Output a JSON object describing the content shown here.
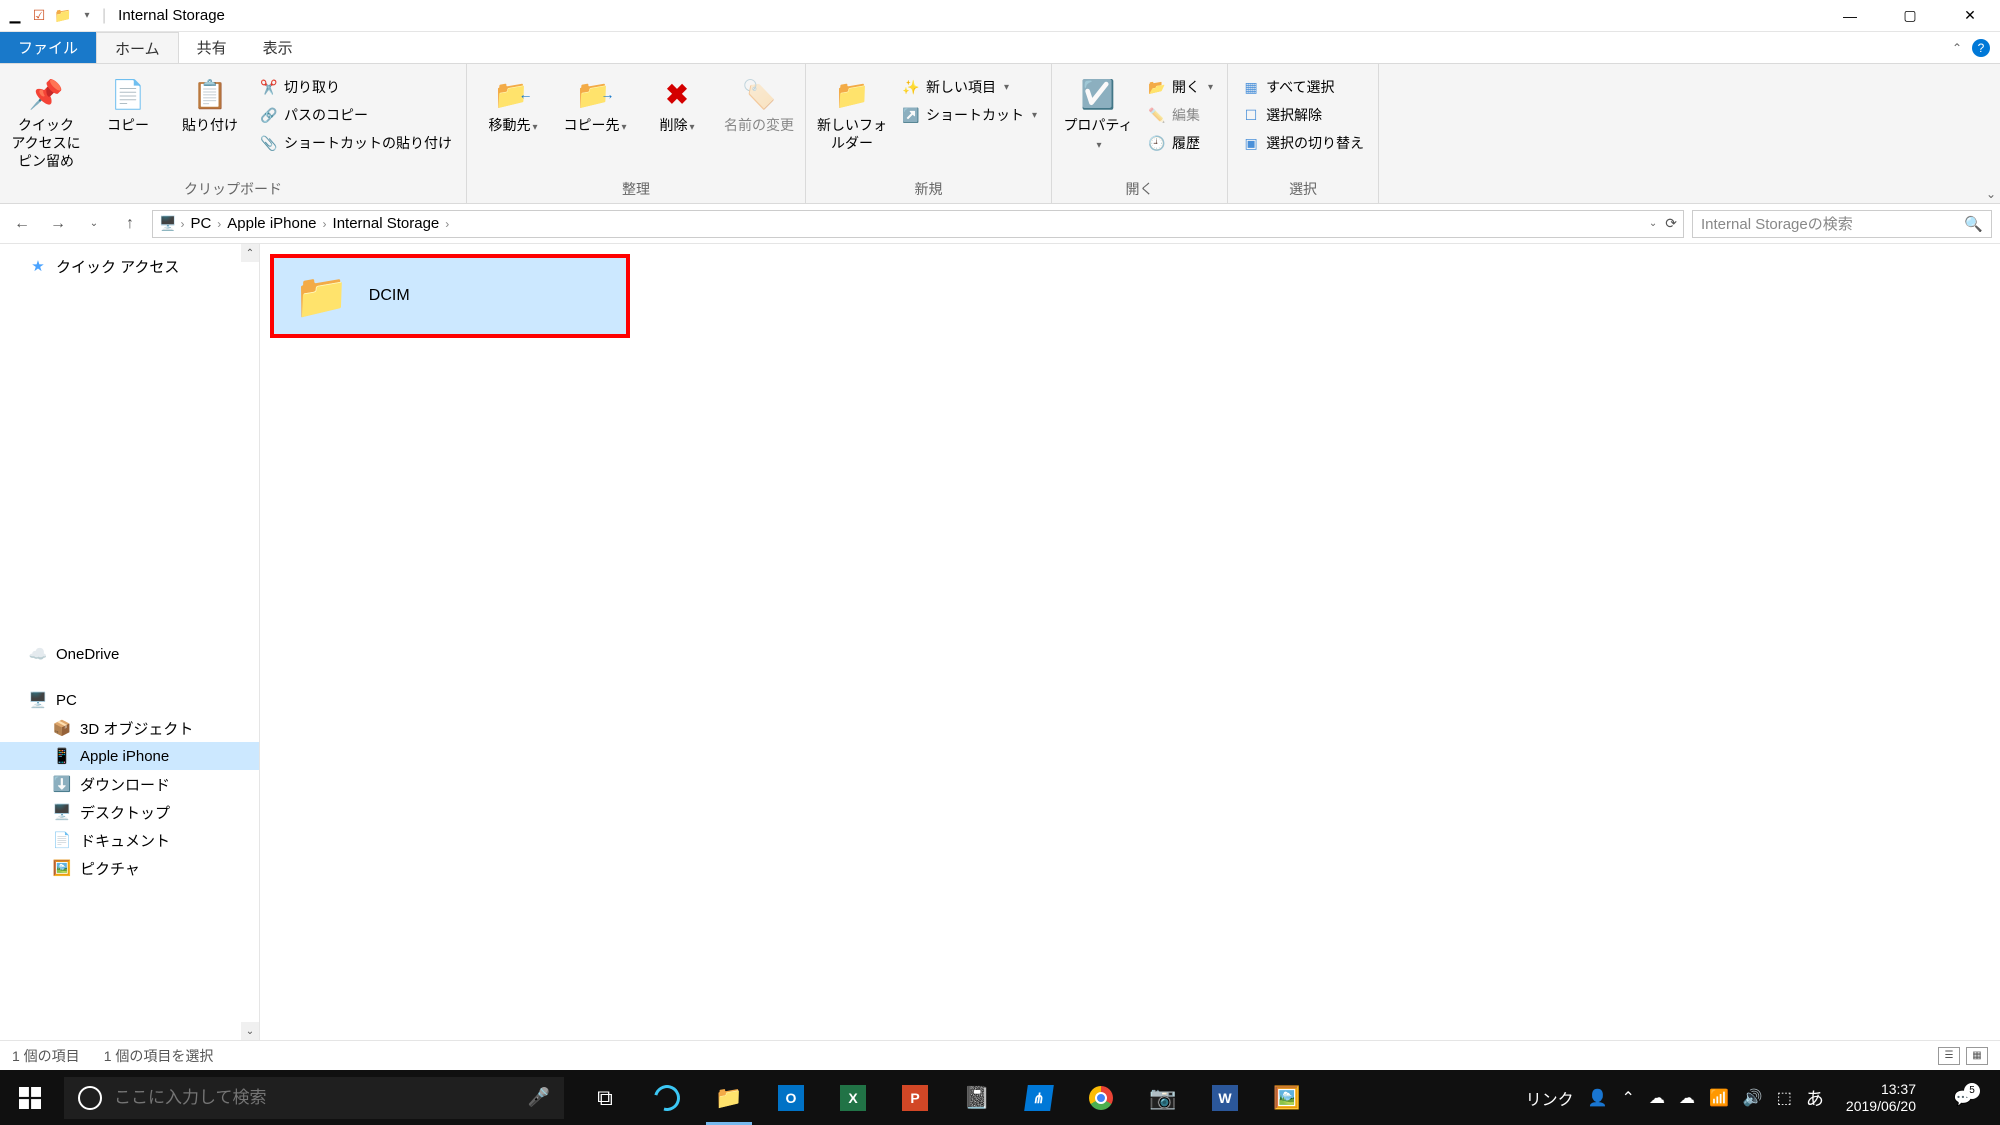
{
  "window": {
    "title": "Internal Storage"
  },
  "tabs": {
    "file": "ファイル",
    "home": "ホーム",
    "share": "共有",
    "view": "表示"
  },
  "ribbon": {
    "clipboard": {
      "label": "クリップボード",
      "pin": "クイック アクセスにピン留め",
      "copy": "コピー",
      "paste": "貼り付け",
      "cut": "切り取り",
      "copypath": "パスのコピー",
      "pasteshortcut": "ショートカットの貼り付け"
    },
    "organize": {
      "label": "整理",
      "moveto": "移動先",
      "copyto": "コピー先",
      "delete": "削除",
      "rename": "名前の変更"
    },
    "new": {
      "label": "新規",
      "newfolder": "新しいフォルダー",
      "newitem": "新しい項目",
      "shortcut": "ショートカット"
    },
    "open": {
      "label": "開く",
      "properties": "プロパティ",
      "open": "開く",
      "edit": "編集",
      "history": "履歴"
    },
    "select": {
      "label": "選択",
      "selectall": "すべて選択",
      "selectnone": "選択解除",
      "invert": "選択の切り替え"
    }
  },
  "breadcrumb": {
    "items": [
      "PC",
      "Apple iPhone",
      "Internal Storage"
    ]
  },
  "search": {
    "placeholder": "Internal Storageの検索"
  },
  "sidebar": {
    "quickaccess": "クイック アクセス",
    "onedrive": "OneDrive",
    "pc": "PC",
    "items": {
      "3dobjects": "3D オブジェクト",
      "iphone": "Apple iPhone",
      "downloads": "ダウンロード",
      "desktop": "デスクトップ",
      "documents": "ドキュメント",
      "pictures": "ピクチャ"
    }
  },
  "content": {
    "dcim": "DCIM"
  },
  "statusbar": {
    "count": "1 個の項目",
    "selected": "1 個の項目を選択"
  },
  "taskbar": {
    "search_placeholder": "ここに入力して検索",
    "link": "リンク",
    "ime": "あ",
    "time": "13:37",
    "date": "2019/06/20",
    "notif_count": "5"
  }
}
